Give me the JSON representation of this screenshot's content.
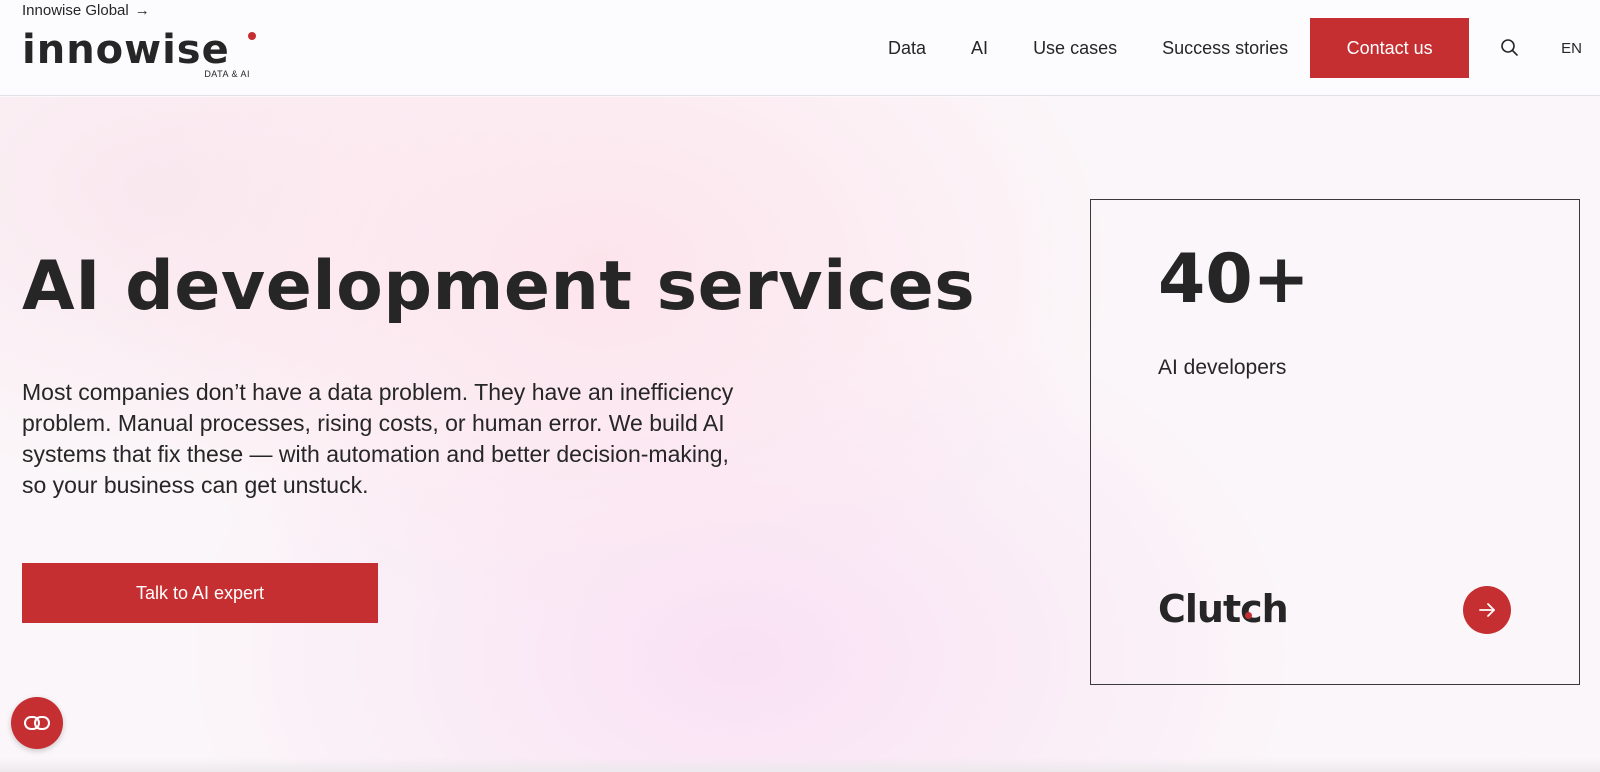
{
  "header": {
    "global_link": "Innowise Global",
    "global_arrow": "→",
    "logo_word": "innowise",
    "logo_sub": "DATA & AI",
    "nav": [
      "Data",
      "AI",
      "Use cases",
      "Success stories"
    ],
    "contact_label": "Contact us",
    "language": "EN"
  },
  "hero": {
    "title": "AI development services",
    "description": "Most companies don’t have a data problem. They have an inefficiency problem. Manual processes, rising costs, or human error. We build AI systems that fix these — with automation and better decision-making, so your business can get unstuck.",
    "cta_label": "Talk to AI expert"
  },
  "stat_card": {
    "value": "40+",
    "label": "AI developers",
    "brand": "Clutch"
  },
  "colors": {
    "accent": "#c62f32",
    "text": "#262626"
  },
  "icons": [
    "search-icon",
    "arrow-right-icon",
    "chat-icon"
  ]
}
